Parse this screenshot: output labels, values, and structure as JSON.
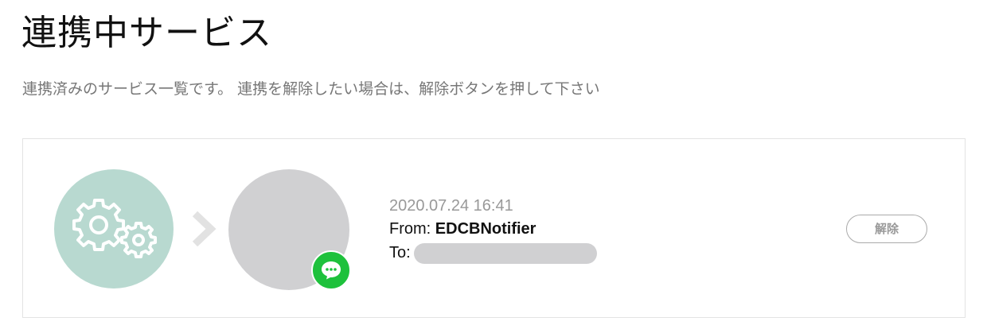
{
  "header": {
    "title": "連携中サービス",
    "description": "連携済みのサービス一覧です。 連携を解除したい場合は、解除ボタンを押して下さい"
  },
  "services": [
    {
      "service_icon": "gears-icon",
      "arrow_icon": "chevron-right-icon",
      "badge_icon": "chat-bubble-icon",
      "date": "2020.07.24 16:41",
      "from_label": "From:",
      "from_value": "EDCBNotifier",
      "to_label": "To:",
      "unlink_label": "解除"
    }
  ],
  "colors": {
    "service_icon_bg": "#b8d9d0",
    "badge_bg": "#1ec13c",
    "avatar_placeholder": "#d0d0d2",
    "muted_text": "#777777"
  }
}
